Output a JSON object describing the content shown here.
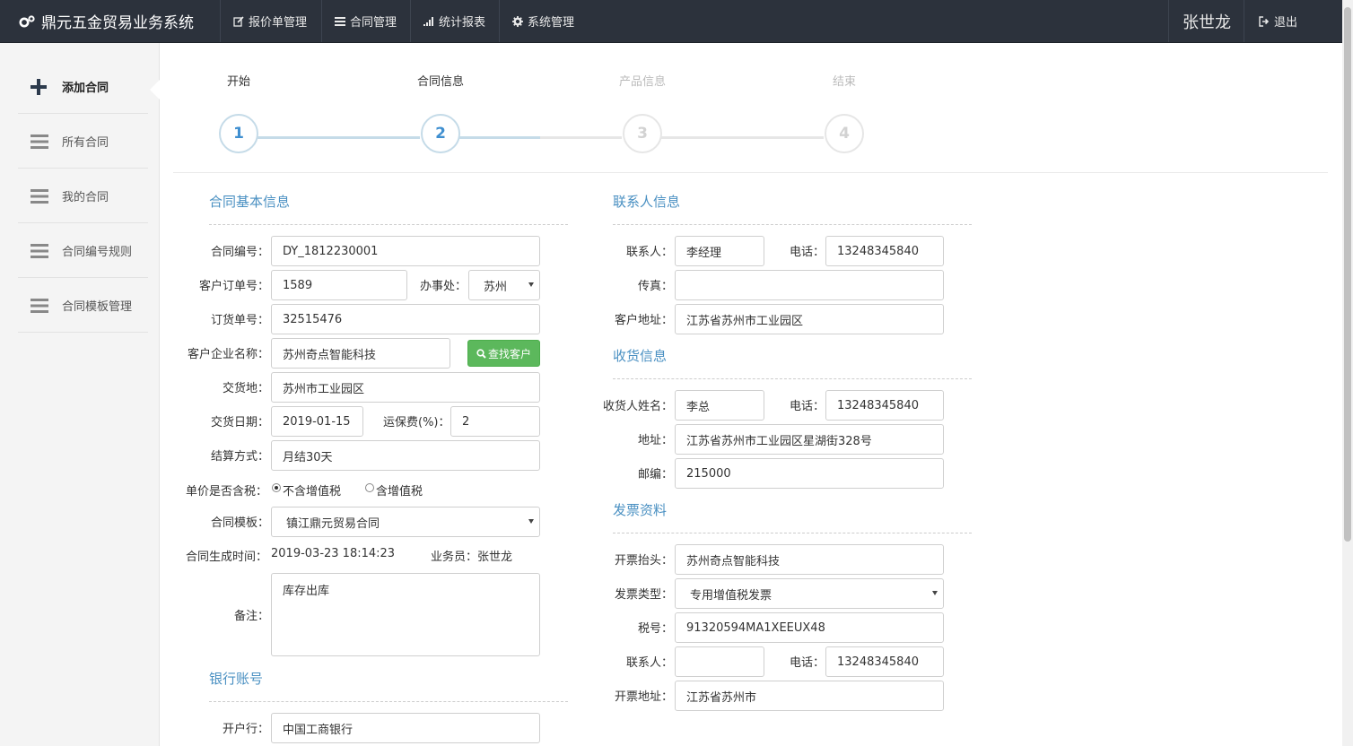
{
  "navbar": {
    "brand": "鼎元五金贸易业务系统",
    "items": [
      {
        "label": "报价单管理",
        "icon": "edit-icon"
      },
      {
        "label": "合同管理",
        "icon": "list-icon"
      },
      {
        "label": "统计报表",
        "icon": "bar-chart-icon"
      },
      {
        "label": "系统管理",
        "icon": "gear-icon"
      }
    ],
    "user": "张世龙",
    "logout": "退出"
  },
  "sidebar": {
    "items": [
      {
        "label": "添加合同",
        "icon": "plus-icon"
      },
      {
        "label": "所有合同",
        "icon": "menu-icon"
      },
      {
        "label": "我的合同",
        "icon": "menu-icon"
      },
      {
        "label": "合同编号规则",
        "icon": "menu-icon"
      },
      {
        "label": "合同模板管理",
        "icon": "menu-icon"
      }
    ]
  },
  "steps": [
    {
      "label": "开始",
      "num": "1"
    },
    {
      "label": "合同信息",
      "num": "2"
    },
    {
      "label": "产品信息",
      "num": "3"
    },
    {
      "label": "结束",
      "num": "4"
    }
  ],
  "basic": {
    "title": "合同基本信息",
    "contract_no_label": "合同编号：",
    "contract_no": "DY_1812230001",
    "cust_order_label": "客户订单号：",
    "cust_order": "1589",
    "office_label": "办事处：",
    "office": "苏州",
    "order_no_label": "订货单号：",
    "order_no": "32515476",
    "company_label": "客户企业名称：",
    "company": "苏州奇点智能科技",
    "find_btn": "查找客户",
    "delivery_place_label": "交货地：",
    "delivery_place": "苏州市工业园区",
    "delivery_date_label": "交货日期：",
    "delivery_date": "2019-01-15",
    "freight_label": "运保费(%)：",
    "freight": "2",
    "settle_label": "结算方式：",
    "settle": "月结30天",
    "tax_label": "单价是否含税：",
    "tax_opt1": "不含增值税",
    "tax_opt2": "含增值税",
    "template_label": "合同模板：",
    "template": "镇江鼎元贸易合同",
    "gen_time_label": "合同生成时间：",
    "gen_time": "2019-03-23 18:14:23",
    "salesman_label": "业务员：",
    "salesman": "张世龙",
    "remark_label": "备注：",
    "remark": "库存出库"
  },
  "bank": {
    "title": "银行账号",
    "bank_label": "开户行：",
    "bank": "中国工商银行"
  },
  "contact": {
    "title": "联系人信息",
    "name_label": "联系人：",
    "name": "李经理",
    "phone_label": "电话：",
    "phone": "13248345840",
    "fax_label": "传真：",
    "fax": "",
    "addr_label": "客户地址：",
    "addr": "江苏省苏州市工业园区"
  },
  "receive": {
    "title": "收货信息",
    "name_label": "收货人姓名：",
    "name": "李总",
    "phone_label": "电话：",
    "phone": "13248345840",
    "addr_label": "地址：",
    "addr": "江苏省苏州市工业园区星湖街328号",
    "zip_label": "邮编：",
    "zip": "215000"
  },
  "invoice": {
    "title": "发票资料",
    "head_label": "开票抬头：",
    "head": "苏州奇点智能科技",
    "type_label": "发票类型：",
    "type": "专用增值税发票",
    "taxno_label": "税号：",
    "taxno": "91320594MA1XEEUX48",
    "contact_label": "联系人：",
    "contact": "",
    "phone_label": "电话：",
    "phone": "13248345840",
    "addr_label": "开票地址：",
    "addr": "江苏省苏州市"
  }
}
